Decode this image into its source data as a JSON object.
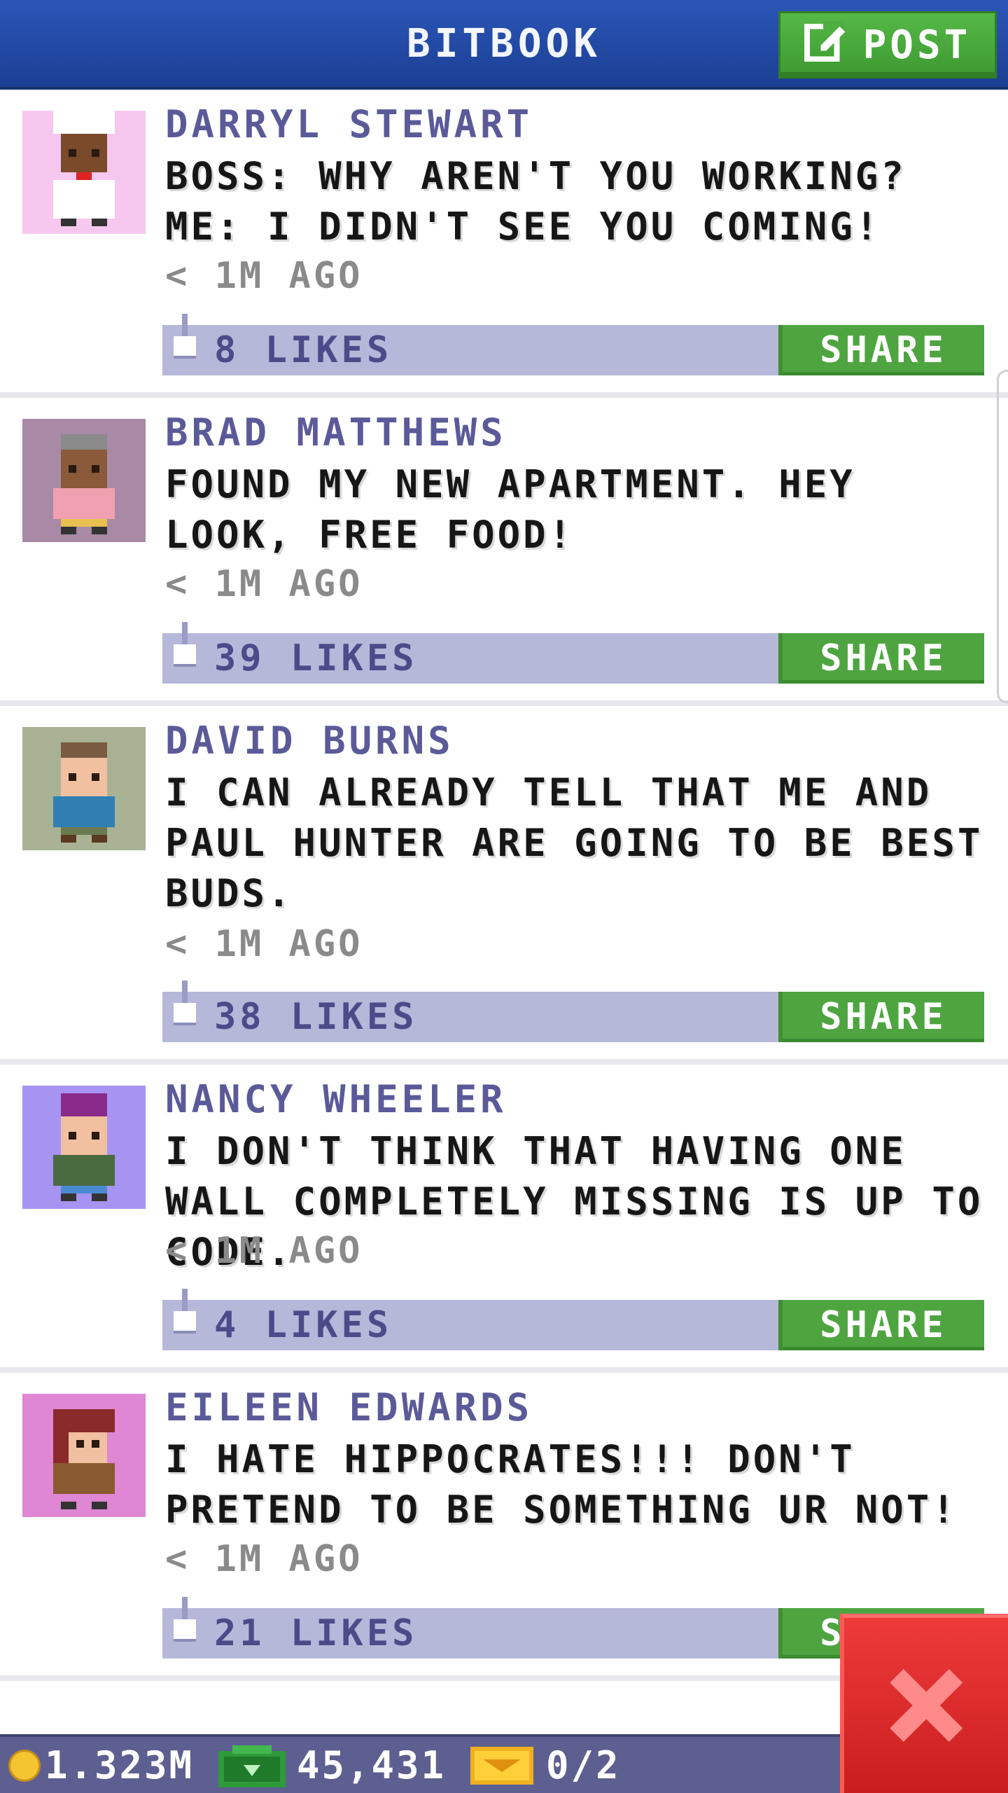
{
  "header": {
    "title": "BITBOOK",
    "post_label": "POST"
  },
  "posts": [
    {
      "author": "DARRYL STEWART",
      "message": "BOSS: WHY AREN'T YOU WORKING? ME: I DIDN'T SEE YOU COMING!",
      "time": "< 1M AGO",
      "likes": "8 LIKES",
      "share": "SHARE",
      "avatar_color": "#f6c8f0"
    },
    {
      "author": "BRAD MATTHEWS",
      "message": "FOUND MY NEW APARTMENT. HEY LOOK, FREE FOOD!",
      "time": "< 1M AGO",
      "likes": "39 LIKES",
      "share": "SHARE",
      "avatar_color": "#a98aa6"
    },
    {
      "author": "DAVID BURNS",
      "message": "I CAN ALREADY TELL THAT ME AND PAUL HUNTER ARE GOING TO BE BEST BUDS.",
      "time": "< 1M AGO",
      "likes": "38 LIKES",
      "share": "SHARE",
      "avatar_color": "#a9b295"
    },
    {
      "author": "NANCY WHEELER",
      "message": "I DON'T THINK THAT HAVING ONE WALL COMPLETELY MISSING IS UP TO CODE.",
      "time": "< 1M AGO",
      "likes": "4 LIKES",
      "share": "SHARE",
      "avatar_color": "#a793f2"
    },
    {
      "author": "EILEEN EDWARDS",
      "message": "I HATE HIPPOCRATES!!! DON'T PRETEND TO BE SOMETHING UR NOT!",
      "time": "< 1M AGO",
      "likes": "21 LIKES",
      "share": "SHARE",
      "avatar_color": "#df86d4"
    }
  ],
  "status": {
    "coins": "1.323M",
    "bux": "45,431",
    "tickets": "0/2"
  },
  "icons": {
    "post": "edit-icon",
    "like": "thumbs-up-icon",
    "coin": "coin-icon",
    "bux": "bux-icon",
    "ticket": "ticket-icon",
    "close": "close-icon"
  },
  "colors": {
    "header": "#2b56b8",
    "accent_green": "#4ea540",
    "likes_bar": "#b6b8d9",
    "author": "#5b5a99",
    "close": "#e02a2a"
  }
}
